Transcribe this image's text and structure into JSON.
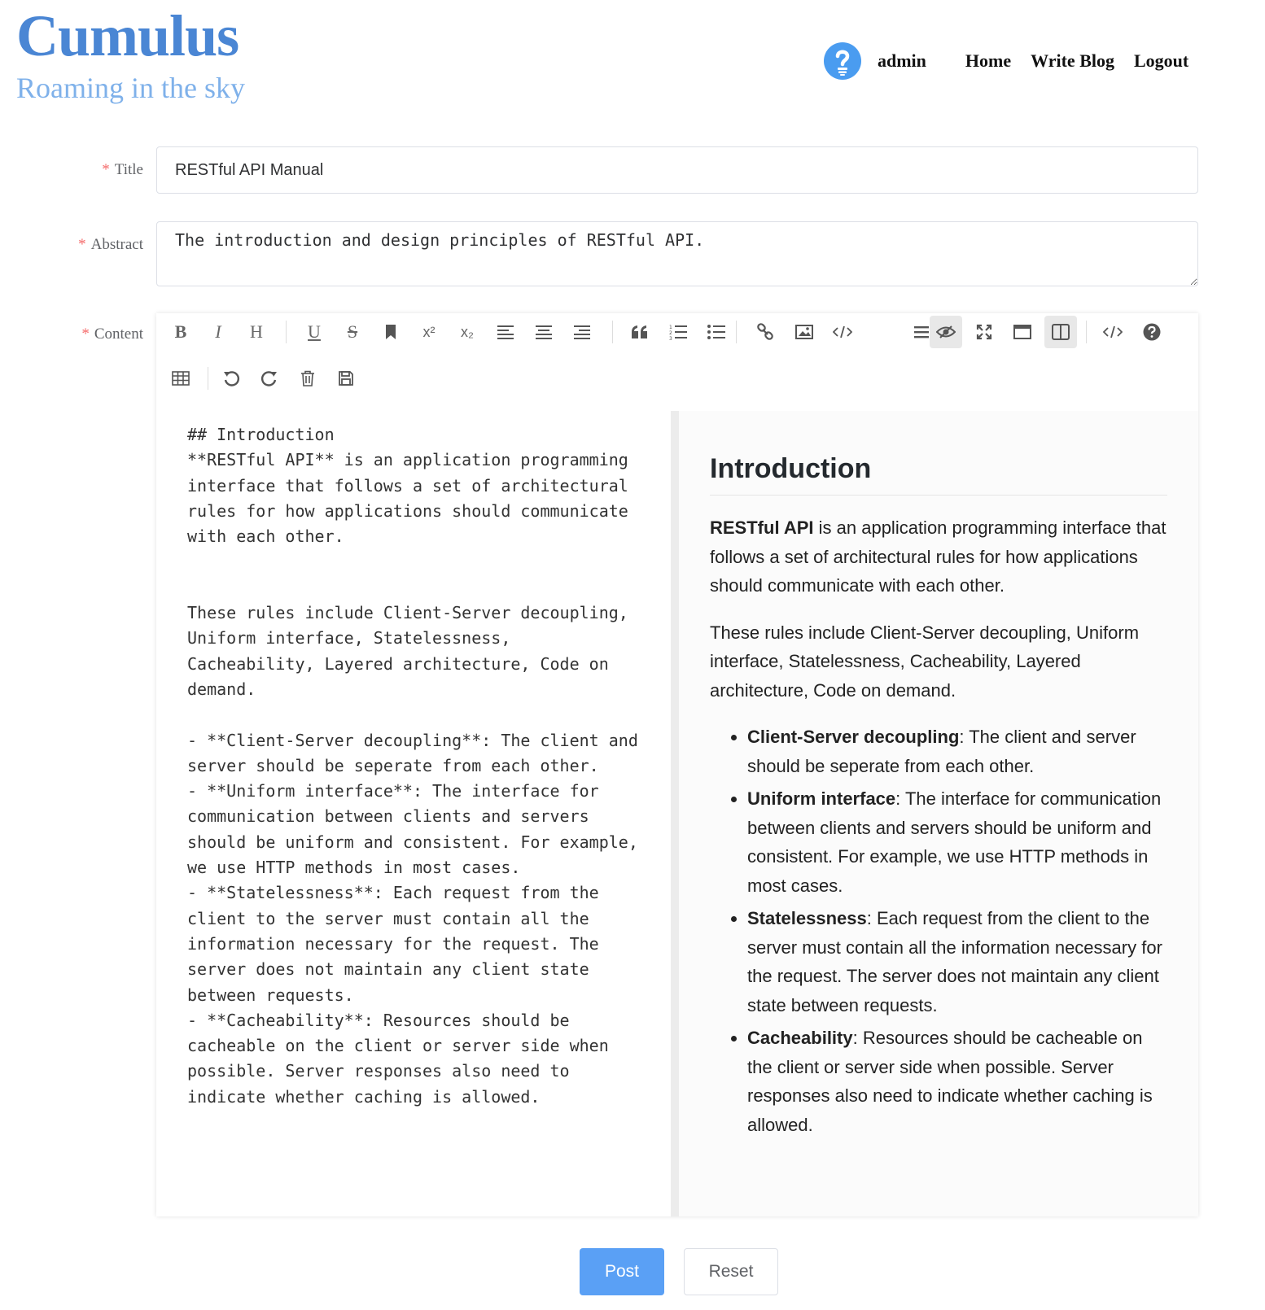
{
  "brand": {
    "title": "Cumulus",
    "subtitle": "Roaming in the sky"
  },
  "nav": {
    "user": "admin",
    "home": "Home",
    "write_blog": "Write Blog",
    "logout": "Logout"
  },
  "form": {
    "title_label": "Title",
    "title_value": "RESTful API Manual",
    "abstract_label": "Abstract",
    "abstract_value": "The introduction and design principles of RESTful API.",
    "content_label": "Content",
    "required_mark": "*"
  },
  "toolbar": {
    "bold": "B",
    "italic": "I",
    "heading": "H",
    "underline": "U",
    "strike": "S",
    "superscript": "x²",
    "subscript": "x₂"
  },
  "editor": {
    "source": "## Introduction\n**RESTful API** is an application programming interface that follows a set of architectural rules for how applications should communicate with each other.\n\n\nThese rules include Client-Server decoupling, Uniform interface, Statelessness, Cacheability, Layered architecture, Code on demand.\n\n- **Client-Server decoupling**: The client and server should be seperate from each other.\n- **Uniform interface**: The interface for communication between clients and servers should be uniform and consistent. For example, we use HTTP methods in most cases.\n- **Statelessness**: Each request from the client to the server must contain all the information necessary for the request. The server does not maintain any client state between requests.\n- **Cacheability**: Resources should be cacheable on the client or server side when possible. Server responses also need to indicate whether caching is allowed."
  },
  "preview": {
    "heading": "Introduction",
    "p1_bold": "RESTful API",
    "p1_rest": " is an application programming interface that follows a set of architectural rules for how applications should communicate with each other.",
    "p2": "These rules include Client-Server decoupling, Uniform interface, Statelessness, Cacheability, Layered architecture, Code on demand.",
    "items": [
      {
        "term": "Client-Server decoupling",
        "text": ": The client and server should be seperate from each other."
      },
      {
        "term": "Uniform interface",
        "text": ": The interface for communication between clients and servers should be uniform and consistent. For example, we use HTTP methods in most cases."
      },
      {
        "term": "Statelessness",
        "text": ": Each request from the client to the server must contain all the information necessary for the request. The server does not maintain any client state between requests."
      },
      {
        "term": "Cacheability",
        "text": ": Resources should be cacheable on the client or server side when possible. Server responses also need to indicate whether caching is allowed."
      }
    ]
  },
  "buttons": {
    "post": "Post",
    "reset": "Reset"
  },
  "colors": {
    "brand": "#4a86d4",
    "subtitle": "#7fb1ea",
    "primary": "#5aa0f5",
    "required": "#f56c6c"
  }
}
